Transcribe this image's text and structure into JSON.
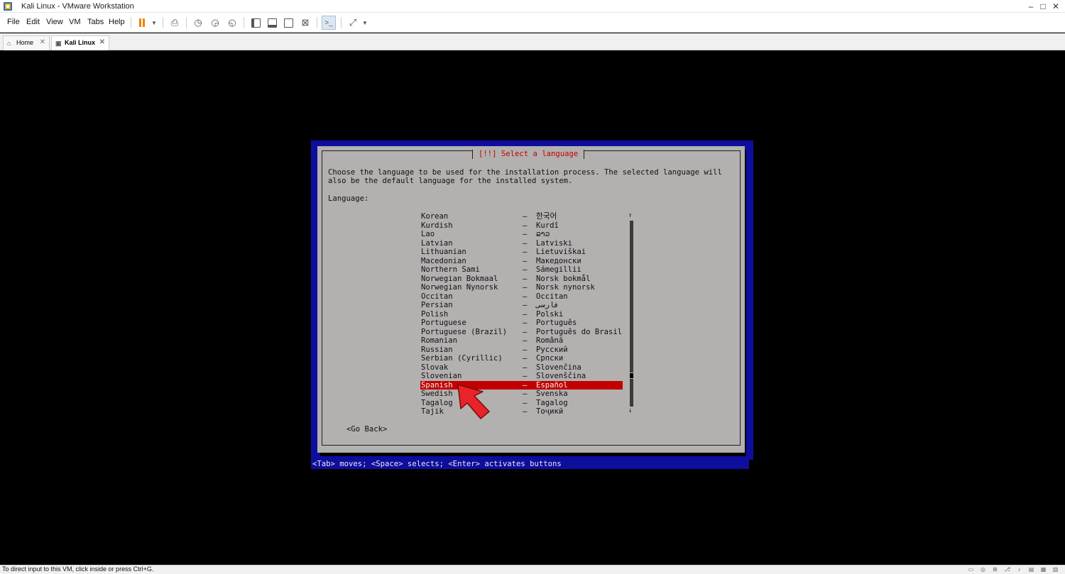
{
  "window": {
    "title": "Kali Linux - VMware Workstation",
    "minimize": "–",
    "maximize": "□",
    "close": "✕"
  },
  "menu": {
    "file": "File",
    "edit": "Edit",
    "view": "View",
    "vm": "VM",
    "tabs": "Tabs",
    "help": "Help"
  },
  "tabs": {
    "home": "Home",
    "kali": "Kali Linux",
    "close": "✕"
  },
  "installer": {
    "title": "[!!] Select a language",
    "description_line1": "Choose the language to be used for the installation process. The selected language will",
    "description_line2": "also be the default language for the installed system.",
    "language_label": "Language:",
    "languages": [
      {
        "name": "Korean",
        "native": "한국어"
      },
      {
        "name": "Kurdish",
        "native": "Kurdî"
      },
      {
        "name": "Lao",
        "native": "ລາວ"
      },
      {
        "name": "Latvian",
        "native": "Latviski"
      },
      {
        "name": "Lithuanian",
        "native": "Lietuviškai"
      },
      {
        "name": "Macedonian",
        "native": "Македонски"
      },
      {
        "name": "Northern Sami",
        "native": "Sámegillii"
      },
      {
        "name": "Norwegian Bokmaal",
        "native": "Norsk bokmål"
      },
      {
        "name": "Norwegian Nynorsk",
        "native": "Norsk nynorsk"
      },
      {
        "name": "Occitan",
        "native": "Occitan"
      },
      {
        "name": "Persian",
        "native": "فارسی"
      },
      {
        "name": "Polish",
        "native": "Polski"
      },
      {
        "name": "Portuguese",
        "native": "Português"
      },
      {
        "name": "Portuguese (Brazil)",
        "native": "Português do Brasil"
      },
      {
        "name": "Romanian",
        "native": "Română"
      },
      {
        "name": "Russian",
        "native": "Русский"
      },
      {
        "name": "Serbian (Cyrillic)",
        "native": "Српски"
      },
      {
        "name": "Slovak",
        "native": "Slovenčina"
      },
      {
        "name": "Slovenian",
        "native": "Slovenščina"
      },
      {
        "name": "Spanish",
        "native": "Español"
      },
      {
        "name": "Swedish",
        "native": "Svenska"
      },
      {
        "name": "Tagalog",
        "native": "Tagalog"
      },
      {
        "name": "Tajik",
        "native": "Тоҷикӣ"
      }
    ],
    "selected_language": "Spanish",
    "separator": "–",
    "scroll_up": "↑",
    "scroll_down": "↓",
    "go_back": "<Go Back>",
    "help_line": "<Tab> moves; <Space> selects; <Enter> activates buttons"
  },
  "statusbar": {
    "text": "To direct input to this VM, click inside or press Ctrl+G."
  },
  "colors": {
    "installer_blue": "#0e0e9e",
    "dialog_gray": "#b3b0b0",
    "selection_red": "#c20000",
    "title_red": "#c60000",
    "pointer_red": "#e8232a"
  }
}
